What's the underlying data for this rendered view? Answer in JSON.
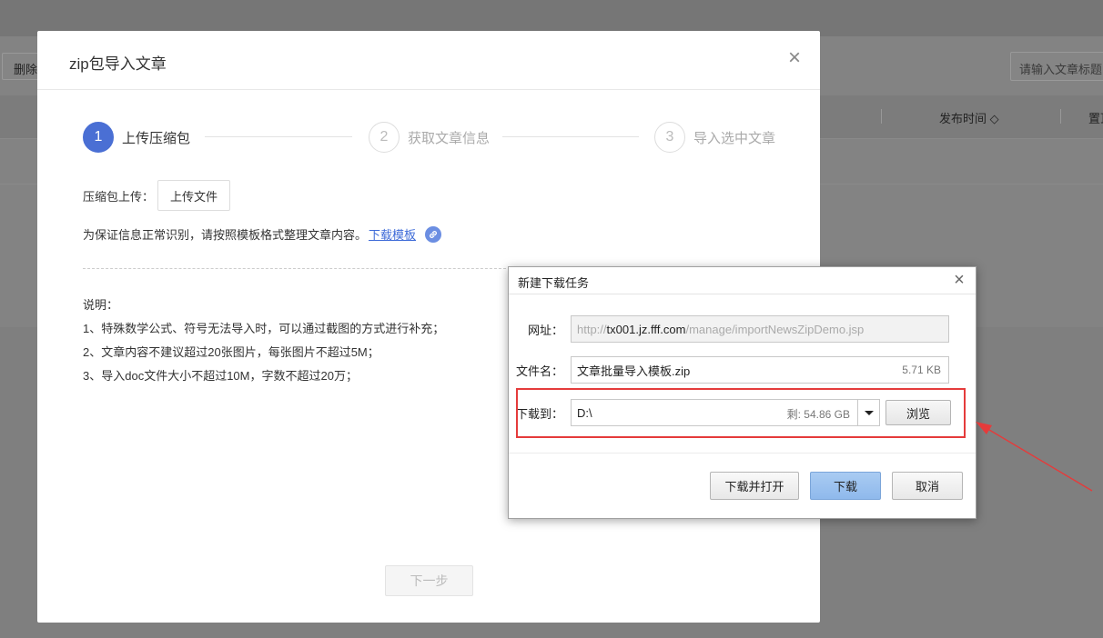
{
  "background": {
    "delete_button": "删除",
    "search_placeholder": "请输入文章标题",
    "columns": {
      "publish_time": "发布时间 ◇",
      "pin": "置顶"
    }
  },
  "modal": {
    "title": "zip包导入文章",
    "close_icon": "×",
    "steps": [
      {
        "num": "1",
        "label": "上传压缩包"
      },
      {
        "num": "2",
        "label": "获取文章信息"
      },
      {
        "num": "3",
        "label": "导入选中文章"
      }
    ],
    "upload_label": "压缩包上传：",
    "upload_button": "上传文件",
    "hint_text": "为保证信息正常识别，请按照模板格式整理文章内容。",
    "hint_link": "下载模板",
    "notes": [
      "说明：",
      "1、特殊数学公式、符号无法导入时，可以通过截图的方式进行补充；",
      "2、文章内容不建议超过20张图片，每张图片不超过5M；",
      "3、导入doc文件大小不超过10M，字数不超过20万；"
    ],
    "next_button": "下一步"
  },
  "download_dialog": {
    "title": "新建下载任务",
    "close_icon": "×",
    "url_label": "网址：",
    "url_prefix": "http://",
    "url_host": "tx001.jz.fff.com",
    "url_path": "/manage/importNewsZipDemo.jsp",
    "filename_label": "文件名：",
    "filename": "文章批量导入模板.zip",
    "file_size": "5.71 KB",
    "dest_label": "下载到：",
    "dest_path": "D:\\",
    "dest_space": "剩: 54.86 GB",
    "browse_button": "浏览",
    "buttons": {
      "download_open": "下载并打开",
      "download": "下载",
      "cancel": "取消"
    }
  },
  "colors": {
    "accent": "#4a6fd4",
    "highlight_box": "#e53b3b",
    "link": "#3e6bd8"
  }
}
